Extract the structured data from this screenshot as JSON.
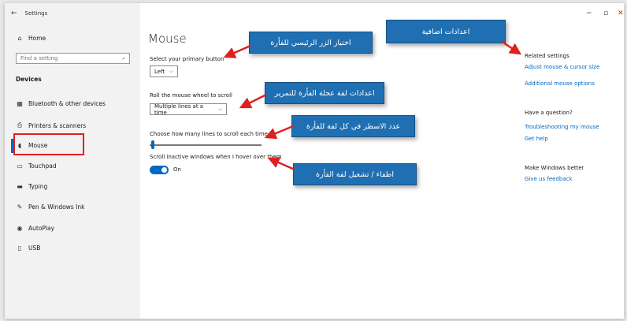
{
  "window": {
    "title": "Settings",
    "back_icon": "back-arrow-icon",
    "controls": {
      "minimize": "−",
      "maximize": "▫",
      "close": "✕"
    }
  },
  "sidebar": {
    "home_label": "Home",
    "search_placeholder": "Find a setting",
    "section_title": "Devices",
    "items": [
      {
        "label": "Bluetooth & other devices",
        "icon": "bluetooth-devices-icon",
        "glyph": "▦"
      },
      {
        "label": "Printers & scanners",
        "icon": "printer-icon",
        "glyph": "⎙"
      },
      {
        "label": "Mouse",
        "icon": "mouse-icon",
        "glyph": "◖",
        "selected": true
      },
      {
        "label": "Touchpad",
        "icon": "touchpad-icon",
        "glyph": "▭"
      },
      {
        "label": "Typing",
        "icon": "keyboard-icon",
        "glyph": "▬"
      },
      {
        "label": "Pen & Windows Ink",
        "icon": "pen-icon",
        "glyph": "✎"
      },
      {
        "label": "AutoPlay",
        "icon": "autoplay-icon",
        "glyph": "◉"
      },
      {
        "label": "USB",
        "icon": "usb-icon",
        "glyph": "▯"
      }
    ]
  },
  "main": {
    "title": "Mouse",
    "primary_button_label": "Select your primary button",
    "primary_button_value": "Left",
    "wheel_label": "Roll the mouse wheel to scroll",
    "wheel_value": "Multiple lines at a time",
    "lines_label": "Choose how many lines to scroll each time",
    "lines_value": 3,
    "inactive_label": "Scroll inactive windows when I hover over them",
    "inactive_state": "On"
  },
  "related": {
    "title": "Related settings",
    "link1": "Adjust mouse & cursor size",
    "link2": "Additional mouse options",
    "question_title": "Have a question?",
    "link3": "Troubleshooting my mouse",
    "link4": "Get help",
    "better_title": "Make Windows better",
    "link5": "Give us feedback"
  },
  "annotations": {
    "extra_settings": "اعدادات اضافية",
    "primary_button": "اختيار الزر الرئيسي للفأرة",
    "wheel_settings": "اعدادات لفة عجلة الفأرة للتمرير",
    "lines_count": "عدد الاسطر في كل لفة للفأرة",
    "toggle": "اطفاء / تشغيل لفة الفأرة"
  },
  "colors": {
    "accent": "#0067c0",
    "callout": "#1f6fb2",
    "arrow": "#e02020",
    "highlight_box": "#e02020"
  }
}
